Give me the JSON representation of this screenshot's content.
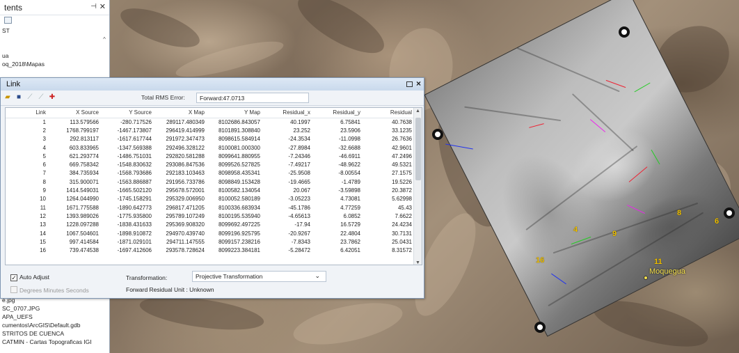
{
  "toc": {
    "title": "tents",
    "rows": [
      "ST",
      "",
      "",
      "ua",
      "oq_2018\\Mapas"
    ],
    "bottom_rows": [
      "e.jpg",
      "SC_0707.JPG",
      "APA_UEFS",
      "cumentos\\ArcGIS\\Default.gdb",
      "STRITOS DE CUENCA",
      "CATMIN - Cartas Topograficas IGI"
    ],
    "pin": "⊣",
    "close": "✕"
  },
  "link": {
    "title": "Link",
    "rms_label": "Total RMS Error:",
    "rms_value": "Forward:47.0713",
    "columns": [
      "Link",
      "X Source",
      "Y Source",
      "X Map",
      "Y Map",
      "Residual_x",
      "Residual_y",
      "Residual"
    ],
    "rows": [
      [
        "1",
        "113.579566",
        "-280.717526",
        "289117.480349",
        "8102686.843057",
        "40.1997",
        "6.75841",
        "40.7638"
      ],
      [
        "2",
        "1768.799197",
        "-1467.173807",
        "296419.414999",
        "8101891.308840",
        "23.252",
        "23.5906",
        "33.1235"
      ],
      [
        "3",
        "292.813117",
        "-1617.617744",
        "291972.347473",
        "8098615.584914",
        "-24.3534",
        "-11.0998",
        "26.7636"
      ],
      [
        "4",
        "603.833965",
        "-1347.569388",
        "292496.328122",
        "8100081.000300",
        "-27.8984",
        "-32.6688",
        "42.9601"
      ],
      [
        "5",
        "621.293774",
        "-1486.751031",
        "292820.581288",
        "8099641.880955",
        "-7.24346",
        "-46.6911",
        "47.2496"
      ],
      [
        "6",
        "669.758342",
        "-1548.830632",
        "293086.847536",
        "8099526.527825",
        "-7.49217",
        "-48.9622",
        "49.5321"
      ],
      [
        "7",
        "384.735934",
        "-1568.793686",
        "292183.103463",
        "8098958.435341",
        "-25.9508",
        "-8.00554",
        "27.1575"
      ],
      [
        "8",
        "315.900071",
        "-1563.886887",
        "291956.733786",
        "8098849.153428",
        "-19.4665",
        "-1.4789",
        "19.5226"
      ],
      [
        "9",
        "1414.549031",
        "-1665.502120",
        "295678.572001",
        "8100582.134054",
        "20.067",
        "-3.59898",
        "20.3872"
      ],
      [
        "10",
        "1264.044990",
        "-1745.158291",
        "295329.006950",
        "8100052.580189",
        "-3.05223",
        "4.73081",
        "5.62998"
      ],
      [
        "11",
        "1671.775588",
        "-1890.642773",
        "296817.471205",
        "8100336.683934",
        "-45.1786",
        "4.77259",
        "45.43"
      ],
      [
        "12",
        "1393.989026",
        "-1775.935800",
        "295789.107249",
        "8100195.535940",
        "-4.65613",
        "6.0852",
        "7.6622"
      ],
      [
        "13",
        "1228.097288",
        "-1838.431633",
        "295369.908320",
        "8099692.497225",
        "-17.94",
        "16.5729",
        "24.4234"
      ],
      [
        "14",
        "1067.504601",
        "-1898.910872",
        "294970.439740",
        "8099196.925795",
        "-20.9267",
        "22.4804",
        "30.7131"
      ],
      [
        "15",
        "997.414584",
        "-1871.029101",
        "294711.147555",
        "8099157.238216",
        "-7.8343",
        "23.7862",
        "25.0431"
      ],
      [
        "16",
        "739.474538",
        "-1697.412606",
        "293578.728624",
        "8099223.384181",
        "-5.28472",
        "6.42051",
        "8.31572"
      ]
    ],
    "auto_adjust_label": "Auto Adjust",
    "auto_adjust_checked": "✓",
    "dms_label": "Degrees Minutes Seconds",
    "transformation_label": "Transformation:",
    "transformation_value": "Projective Transformation",
    "forward_unit": "Forward Residual Unit : Unknown"
  },
  "map": {
    "place_label": "Moquegua",
    "gcp_labels": [
      "8",
      "6",
      "9",
      "4",
      "11",
      "16"
    ]
  },
  "colors": {
    "dialog_bg": "#f0f3f7",
    "title_bar": "#c9d9ec",
    "gcp_label": "#f2c200",
    "place_label": "#f4e04d"
  }
}
